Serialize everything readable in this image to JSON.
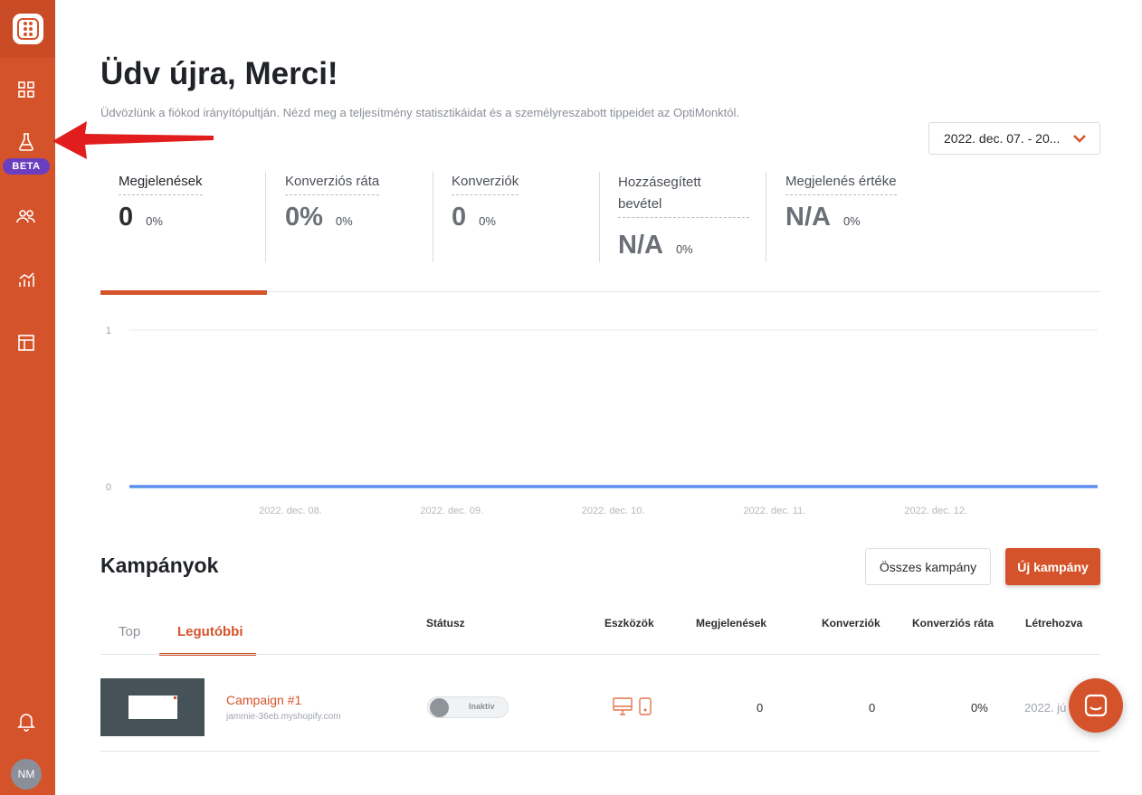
{
  "sidebar": {
    "items": [
      "dashboard-icon",
      "flask-icon",
      "users-icon",
      "chart-icon",
      "layout-icon"
    ],
    "beta_label": "BETA",
    "avatar_initials": "NM"
  },
  "header": {
    "title": "Üdv újra, Merci!",
    "subtitle": "Üdvözlünk a fiókod irányítópultján. Nézd meg a teljesítmény statisztikáidat és a személyreszabott tippeidet az OptiMonktól.",
    "date_range": "2022. dec. 07. - 20..."
  },
  "stats": [
    {
      "label": "Megjelenések",
      "value": "0",
      "change": "0%"
    },
    {
      "label": "Konverziós ráta",
      "value": "0%",
      "change": "0%"
    },
    {
      "label": "Konverziók",
      "value": "0",
      "change": "0%"
    },
    {
      "label_line1": "Hozzásegített",
      "label_line2": "bevétel",
      "value": "N/A",
      "change": "0%"
    },
    {
      "label": "Megjelenés értéke",
      "value": "N/A",
      "change": "0%"
    }
  ],
  "chart_data": {
    "type": "line",
    "x": [
      "2022. dec. 08.",
      "2022. dec. 09.",
      "2022. dec. 10.",
      "2022. dec. 11.",
      "2022. dec. 12."
    ],
    "series": [
      {
        "values": [
          0,
          0,
          0,
          0,
          0
        ]
      }
    ],
    "y_ticks": [
      "1",
      "0"
    ],
    "ylim": [
      0,
      1
    ],
    "color": "#5b8def"
  },
  "campaigns": {
    "title": "Kampányok",
    "all_button": "Összes kampány",
    "new_button": "Új kampány",
    "tabs": [
      "Top",
      "Legutóbbi"
    ],
    "columns": [
      "Státusz",
      "Eszközök",
      "Megjelenések",
      "Konverziók",
      "Konverziós ráta",
      "Létrehozva"
    ],
    "rows": [
      {
        "name": "Campaign #1",
        "domain": "jammie-36eb.myshopify.com",
        "status": "Inaktív",
        "impressions": "0",
        "conversions": "0",
        "rate": "0%",
        "created": "2022. jú"
      }
    ]
  },
  "colors": {
    "accent": "#d5532b",
    "beta": "#6a3fbf"
  }
}
